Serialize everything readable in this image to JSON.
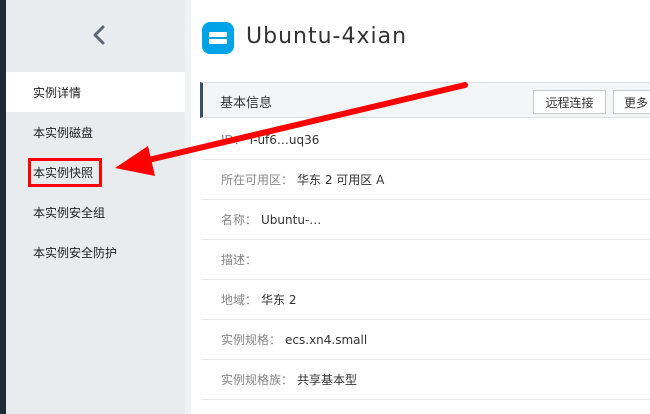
{
  "header": {
    "instance_title": "Ubuntu-4xian"
  },
  "sidebar": {
    "items": [
      {
        "label": "实例详情"
      },
      {
        "label": "本实例磁盘"
      },
      {
        "label": "本实例快照"
      },
      {
        "label": "本实例安全组"
      },
      {
        "label": "本实例安全防护"
      }
    ]
  },
  "panel": {
    "title": "基本信息",
    "remote_button": "远程连接",
    "more_button": "更多"
  },
  "info": {
    "id": {
      "label": "ID：",
      "value": "i-uf6…uq36"
    },
    "zone": {
      "label": "所在可用区：",
      "value": "华东 2 可用区 A"
    },
    "name": {
      "label": "名称：",
      "value": "Ubuntu-…"
    },
    "desc": {
      "label": "描述：",
      "value": ""
    },
    "region": {
      "label": "地域：",
      "value": "华东 2"
    },
    "spec": {
      "label": "实例规格：",
      "value": "ecs.xn4.small"
    },
    "family": {
      "label": "实例规格族：",
      "value": "共享基本型"
    }
  },
  "colors": {
    "sidebar_bg": "#e8ecef",
    "accent": "#00a2e8",
    "annotation_red": "#ff0000",
    "panel_border": "#3d4f63"
  }
}
